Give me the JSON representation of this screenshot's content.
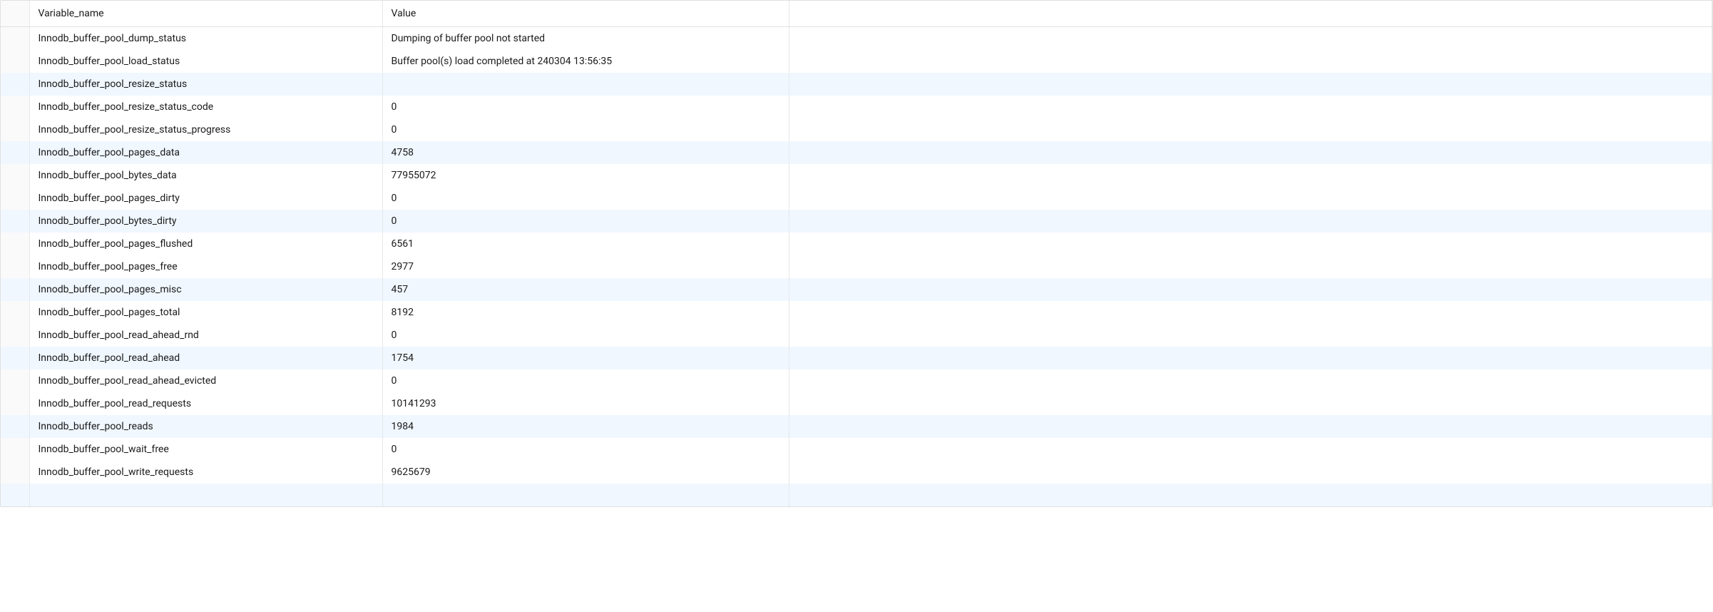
{
  "columns": {
    "variable_name": "Variable_name",
    "value": "Value"
  },
  "rows": [
    {
      "variable_name": "Innodb_buffer_pool_dump_status",
      "value": "Dumping of buffer pool not started",
      "highlight": false
    },
    {
      "variable_name": "Innodb_buffer_pool_load_status",
      "value": "Buffer pool(s) load completed at 240304 13:56:35",
      "highlight": false
    },
    {
      "variable_name": "Innodb_buffer_pool_resize_status",
      "value": "",
      "highlight": true
    },
    {
      "variable_name": "Innodb_buffer_pool_resize_status_code",
      "value": "0",
      "highlight": false
    },
    {
      "variable_name": "Innodb_buffer_pool_resize_status_progress",
      "value": "0",
      "highlight": false
    },
    {
      "variable_name": "Innodb_buffer_pool_pages_data",
      "value": "4758",
      "highlight": true
    },
    {
      "variable_name": "Innodb_buffer_pool_bytes_data",
      "value": "77955072",
      "highlight": false
    },
    {
      "variable_name": "Innodb_buffer_pool_pages_dirty",
      "value": "0",
      "highlight": false
    },
    {
      "variable_name": "Innodb_buffer_pool_bytes_dirty",
      "value": "0",
      "highlight": true
    },
    {
      "variable_name": "Innodb_buffer_pool_pages_flushed",
      "value": "6561",
      "highlight": false
    },
    {
      "variable_name": "Innodb_buffer_pool_pages_free",
      "value": "2977",
      "highlight": false
    },
    {
      "variable_name": "Innodb_buffer_pool_pages_misc",
      "value": "457",
      "highlight": true
    },
    {
      "variable_name": "Innodb_buffer_pool_pages_total",
      "value": "8192",
      "highlight": false
    },
    {
      "variable_name": "Innodb_buffer_pool_read_ahead_rnd",
      "value": "0",
      "highlight": false
    },
    {
      "variable_name": "Innodb_buffer_pool_read_ahead",
      "value": "1754",
      "highlight": true
    },
    {
      "variable_name": "Innodb_buffer_pool_read_ahead_evicted",
      "value": "0",
      "highlight": false
    },
    {
      "variable_name": "Innodb_buffer_pool_read_requests",
      "value": "10141293",
      "highlight": false
    },
    {
      "variable_name": "Innodb_buffer_pool_reads",
      "value": "1984",
      "highlight": true
    },
    {
      "variable_name": "Innodb_buffer_pool_wait_free",
      "value": "0",
      "highlight": false
    },
    {
      "variable_name": "Innodb_buffer_pool_write_requests",
      "value": "9625679",
      "highlight": false
    }
  ]
}
